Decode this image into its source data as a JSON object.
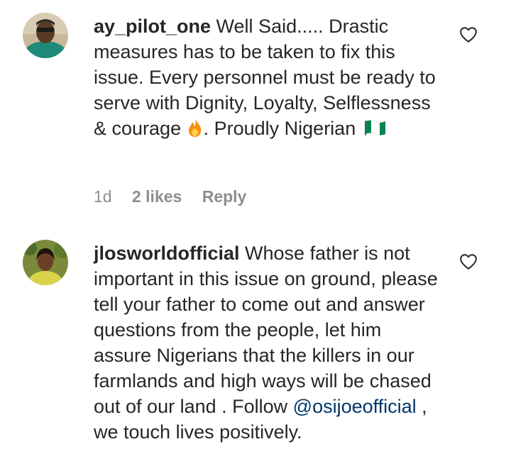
{
  "comments": [
    {
      "username": "ay_pilot_one",
      "text_part1": " Well Said..... Drastic measures has to be taken to fix this issue. Every personnel must be ready to serve with Dignity, Loyalty, Selflessness & courage",
      "text_part2": ". Proudly Nigerian",
      "emoji1": "fire-icon",
      "emoji2": "nigeria-flag-icon",
      "time": "1d",
      "likes": "2 likes",
      "reply": "Reply"
    },
    {
      "username": "jlosworldofficial",
      "text_part1": " Whose father is not important in this issue on ground, please tell your father to come out and answer questions from the people, let him assure Nigerians that the killers in our farmlands and high ways will be chased out of our land . Follow ",
      "mention": "@osijoeofficial",
      "text_part2": " , we touch lives positively."
    }
  ],
  "colors": {
    "text": "#262626",
    "meta": "#8e8e8e",
    "mention": "#00376b",
    "flame": "#f4900c",
    "flag_green": "#008751"
  }
}
